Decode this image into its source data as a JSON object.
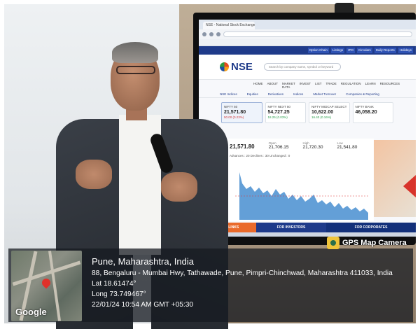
{
  "screen": {
    "tab_title": "NSE - National Stock Exchange",
    "topbar_links": [
      "Option Chain",
      "Listings",
      "IPO",
      "Circulars",
      "Daily Reports",
      "Holidays"
    ],
    "logo_text": "NSE",
    "search_placeholder": "Search by company name, symbol or keyword",
    "menu": [
      "HOME",
      "ABOUT",
      "MARKET DATA",
      "INVEST",
      "LIST",
      "TRADE",
      "REGULATION",
      "LEARN",
      "RESOURCES"
    ],
    "subtabs": [
      "NSE Indices",
      "Equities",
      "Derivatives",
      "Indices",
      "Market Turnover",
      "Companies & Reporting"
    ],
    "indices": [
      {
        "name": "NIFTY 50",
        "value": "21,571.80",
        "change": "50.00 (0.23%)",
        "negative": true
      },
      {
        "name": "NIFTY NEXT 50",
        "value": "54,727.25",
        "change": "18.25 (0.03%)",
        "negative": false
      },
      {
        "name": "NIFTY MIDCAP SELECT",
        "value": "10,622.00",
        "change": "16.40 (0.16%)",
        "negative": false
      },
      {
        "name": "NIFTY BANK",
        "value": "46,058.20",
        "change": "",
        "negative": false
      }
    ],
    "chart_summary": {
      "last": "21,571.80",
      "prev_label": "Open",
      "prev_value": "21,706.15",
      "high_label": "High",
      "high_value": "21,720.30",
      "low_label": "Low",
      "low_value": "21,541.80",
      "legend": "Advances : 20   Declines : 30   Unchanged : 0"
    },
    "bottom_links": [
      "QUICK LINKS",
      "FOR INVESTORS",
      "FOR CORPORATES"
    ]
  },
  "gps": {
    "badge": "GPS Map Camera",
    "map_label": "Google",
    "place": "Pune, Maharashtra, India",
    "address": "88, Bengaluru - Mumbai Hwy, Tathawade, Pune, Pimpri-Chinchwad, Maharashtra 411033, India",
    "lat": "Lat 18.61474°",
    "long": "Long 73.749467°",
    "datetime": "22/01/24 10:54 AM GMT +05:30"
  }
}
